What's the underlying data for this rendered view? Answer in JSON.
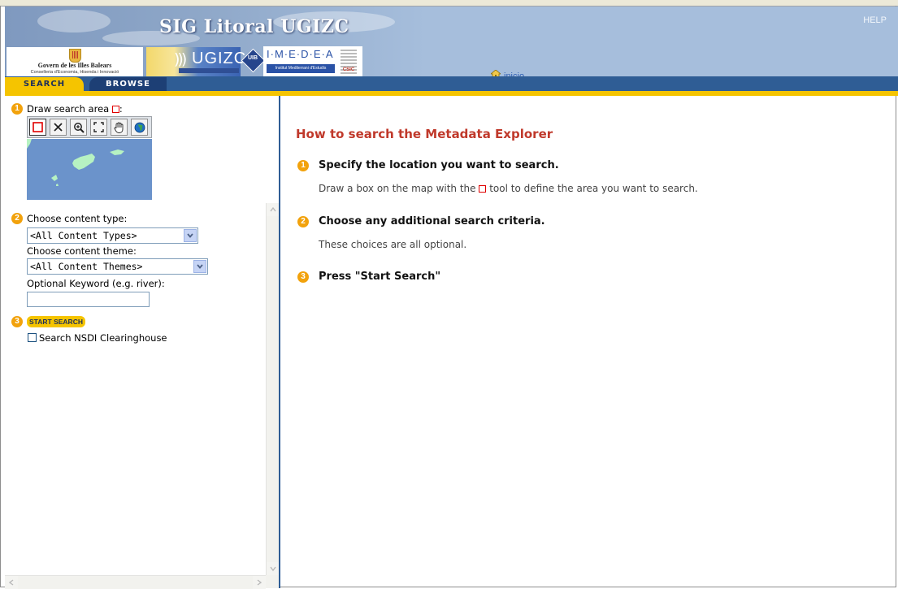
{
  "header": {
    "site_title": "SIG Litoral UGIZC",
    "help_label": "HELP",
    "home_label": "inicio",
    "logos": {
      "govern_name": "Govern de les Illes Balears",
      "govern_department": "Conselleria d'Economia, Hisenda i Innovació",
      "ugizc": "UGIZC",
      "uib": "UIB",
      "imedea": "I·M·E·D·E·A",
      "imedea_sub": "Institut Mediterrani d'Estudis Avançats",
      "csic": "CSIC"
    }
  },
  "tabs": [
    {
      "label": "SEARCH",
      "active": true
    },
    {
      "label": "BROWSE",
      "active": false
    }
  ],
  "search_panel": {
    "step1": {
      "number": "1",
      "label": "Draw search area",
      "suffix": ":"
    },
    "map_tools": [
      "draw-box-icon",
      "clear-icon",
      "zoom-in-icon",
      "full-extent-icon",
      "pan-hand-icon",
      "globe-icon"
    ],
    "step2": {
      "number": "2",
      "content_type_label": "Choose content type:",
      "content_type_value": "<All Content Types>",
      "content_theme_label": "Choose content theme:",
      "content_theme_value": "<All Content Themes>",
      "keyword_label": "Optional Keyword (e.g. river):",
      "keyword_value": ""
    },
    "step3": {
      "number": "3",
      "start_button": "START SEARCH",
      "nsdi_label": "Search NSDI Clearinghouse",
      "nsdi_checked": false
    }
  },
  "help": {
    "title": "How to search the Metadata Explorer",
    "steps": [
      {
        "number": "1",
        "title": "Specify the location you want to search.",
        "desc_before": "Draw a box on the map with the",
        "desc_after": "tool to define the area you want to search."
      },
      {
        "number": "2",
        "title": "Choose any additional search criteria.",
        "desc": "These choices are all optional."
      },
      {
        "number": "3",
        "title": "Press \"Start Search\""
      }
    ]
  },
  "colors": {
    "accent_yellow": "#f5c400",
    "nav_blue": "#2f5d95",
    "title_red": "#c0392b",
    "step_orange": "#f2a20c",
    "map_sea": "#6b93cb",
    "map_land": "#b6f2c2"
  }
}
